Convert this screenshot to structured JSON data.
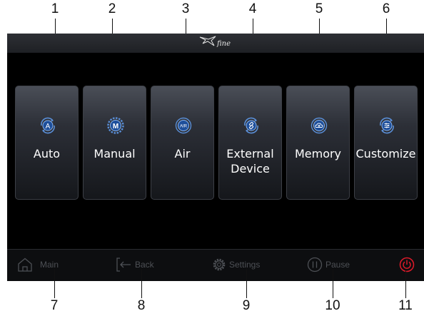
{
  "callouts": [
    "1",
    "2",
    "3",
    "4",
    "5",
    "6",
    "7",
    "8",
    "9",
    "10",
    "11"
  ],
  "header": {
    "logo_text": "fine"
  },
  "tiles": [
    {
      "label": "Auto",
      "icon": "auto-mode-icon"
    },
    {
      "label": "Manual",
      "icon": "manual-mode-icon"
    },
    {
      "label": "Air",
      "icon": "air-mode-icon"
    },
    {
      "label": "External\nDevice",
      "icon": "external-device-icon"
    },
    {
      "label": "Memory",
      "icon": "memory-cloud-icon"
    },
    {
      "label": "Customize",
      "icon": "customize-sliders-icon"
    }
  ],
  "icon_badges": {
    "auto": "A",
    "manual": "M",
    "air": "AIR"
  },
  "bottom_bar": {
    "main": "Main",
    "back": "Back",
    "settings": "Settings",
    "pause": "Pause"
  },
  "colors": {
    "tile_icon_blue": "#5a8fd8",
    "power_red": "#e01a2a",
    "bar_text": "#4d5055"
  }
}
